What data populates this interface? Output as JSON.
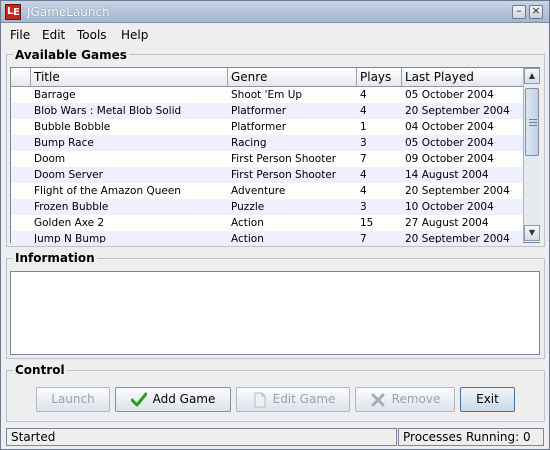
{
  "window": {
    "title": "JGameLaunch",
    "minimize_glyph": "–",
    "close_glyph": "×"
  },
  "menu": [
    {
      "label": "File"
    },
    {
      "label": "Edit"
    },
    {
      "label": "Tools"
    },
    {
      "label": "Help"
    }
  ],
  "games_panel": {
    "title": "Available Games",
    "columns": [
      "Title",
      "Genre",
      "Plays",
      "Last Played"
    ],
    "rows": [
      [
        "Barrage",
        "Shoot 'Em Up",
        "4",
        "05 October 2004"
      ],
      [
        "Blob Wars : Metal Blob Solid",
        "Platformer",
        "4",
        "20 September 2004"
      ],
      [
        "Bubble Bobble",
        "Platformer",
        "1",
        "04 October 2004"
      ],
      [
        "Bump Race",
        "Racing",
        "3",
        "05 October 2004"
      ],
      [
        "Doom",
        "First Person Shooter",
        "7",
        "09 October 2004"
      ],
      [
        "Doom Server",
        "First Person Shooter",
        "4",
        "14 August 2004"
      ],
      [
        "Flight of the Amazon Queen",
        "Adventure",
        "4",
        "20 September 2004"
      ],
      [
        "Frozen Bubble",
        "Puzzle",
        "3",
        "10 October 2004"
      ],
      [
        "Golden Axe 2",
        "Action",
        "15",
        "27 August 2004"
      ],
      [
        "Jump N Bump",
        "Action",
        "7",
        "20 September 2004"
      ]
    ]
  },
  "info_panel": {
    "title": "Information",
    "text": ""
  },
  "control_panel": {
    "title": "Control",
    "buttons": {
      "launch": "Launch",
      "add_game": "Add Game",
      "edit_game": "Edit Game",
      "remove": "Remove",
      "exit": "Exit"
    }
  },
  "status": {
    "left": "Started",
    "right": "Processes Running: 0"
  },
  "icons": {
    "app": "jgamelaunch-logo-icon",
    "add": "checkmark-icon",
    "edit": "document-icon",
    "remove": "x-icon"
  },
  "colors": {
    "alt_row": "#eef0ff",
    "check_green": "#2f9a1f",
    "remove_gray": "#a7adb6"
  }
}
